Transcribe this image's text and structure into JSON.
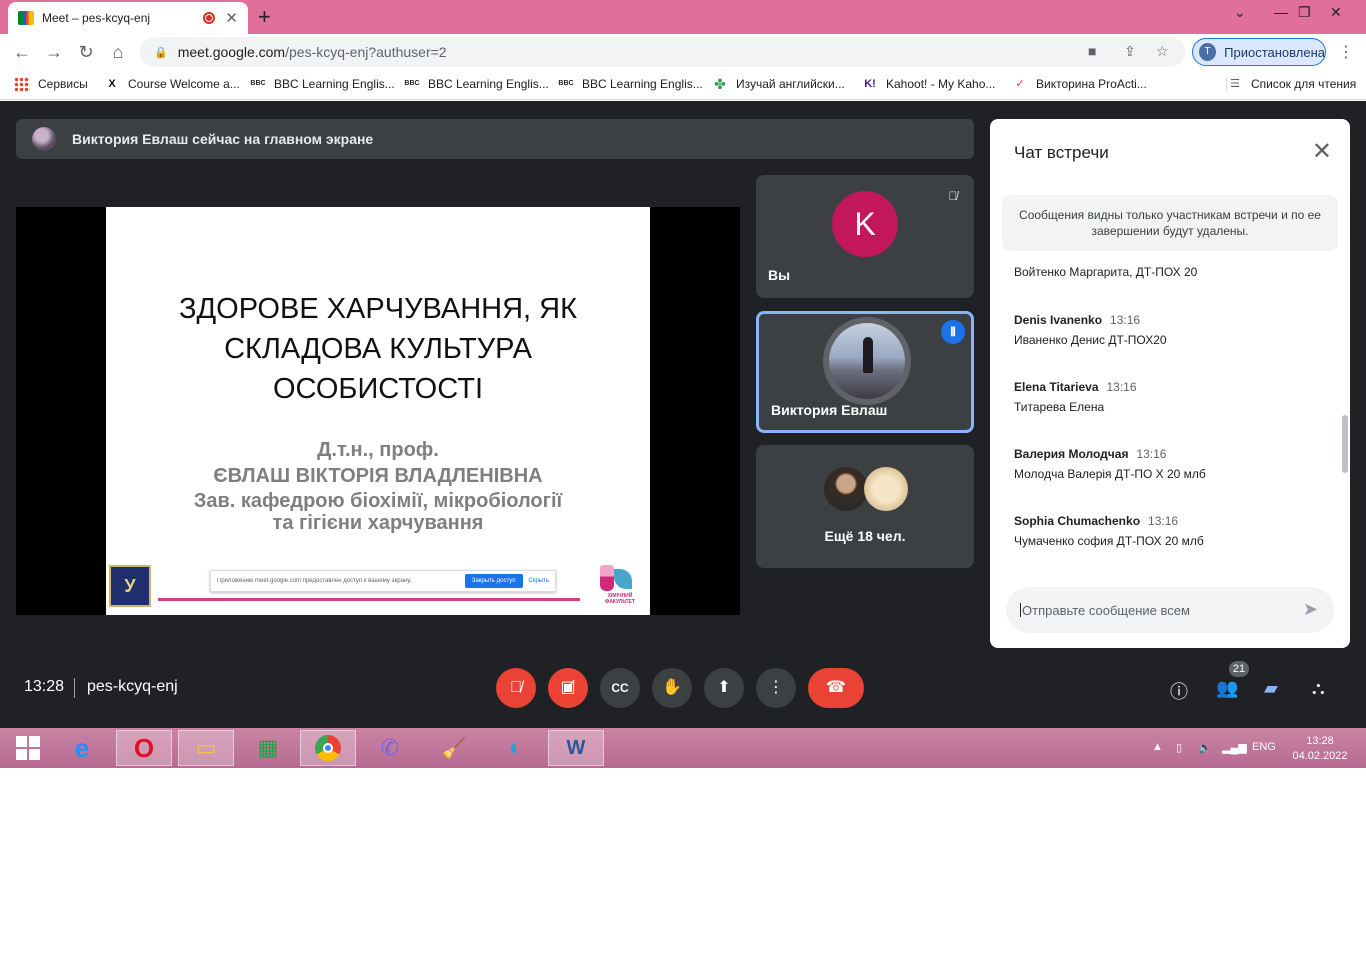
{
  "browser": {
    "tab_title": "Meet – pes-kcyq-enj",
    "url_host": "meet.google.com",
    "url_path": "/pes-kcyq-enj?authuser=2",
    "profile_label": "Приостановлена",
    "profile_initial": "Т",
    "bookmarks": [
      {
        "label": "Сервисы",
        "icon": "apps-grid-icon"
      },
      {
        "label": "Course Welcome a...",
        "icon": "x-icon"
      },
      {
        "label": "BBC Learning Englis...",
        "icon": "bbc-icon"
      },
      {
        "label": "BBC Learning Englis...",
        "icon": "bbc-icon"
      },
      {
        "label": "BBC Learning Englis...",
        "icon": "bbc-icon"
      },
      {
        "label": "Изучай английски...",
        "icon": "clover-icon"
      },
      {
        "label": "Kahoot! - My Kaho...",
        "icon": "kahoot-icon"
      },
      {
        "label": "Викторина ProActi...",
        "icon": "checkmark-icon"
      }
    ],
    "reading_list": "Список для чтения"
  },
  "meet": {
    "presenter_notice": "Виктория Евлаш сейчас на главном экране",
    "slide": {
      "title_lines": [
        "ЗДОРОВЕ ХАРЧУВАННЯ, ЯК",
        "СКЛАДОВА КУЛЬТУРА",
        "ОСОБИСТОСТІ"
      ],
      "author_lines": [
        "Д.т.н., проф.",
        "ЄВЛАШ ВІКТОРІЯ ВЛАДЛЕНІВНА",
        "Зав. кафедрою біохімії, мікробіології",
        "та гігієни харчування"
      ],
      "share_notice": "Приложению meet.google.com предоставлен доступ к вашему экрану.",
      "share_stop": "Закрыть доступ",
      "share_hide": "Скрыть",
      "faculty_label": "ХІМІЧНИЙ ФАКУЛЬТЕТ"
    },
    "tiles": {
      "you_initial": "K",
      "you_label": "Вы",
      "speaker_name": "Виктория Евлаш",
      "more_label": "Ещё 18 чел."
    },
    "chat": {
      "title": "Чат встречи",
      "notice": "Сообщения видны только участникам встречи и по ее завершении будут удалены.",
      "first_line": "Войтенко Маргарита, ДТ-ПОХ 20",
      "messages": [
        {
          "sender": "Denis Ivanenko",
          "time": "13:16",
          "text": "Иваненко Денис ДТ-ПОХ20"
        },
        {
          "sender": "Elena Titarieva",
          "time": "13:16",
          "text": "Титарева Елена"
        },
        {
          "sender": "Валерия Молодчая",
          "time": "13:16",
          "text": "Молодча Валерія ДТ-ПО Х 20 млб"
        },
        {
          "sender": "Sophia Chumachenko",
          "time": "13:16",
          "text": "Чумаченко софия ДТ-ПОХ 20 млб"
        }
      ],
      "input_placeholder": "Отправьте сообщение всем"
    },
    "bottom": {
      "time": "13:28",
      "meeting_code": "pes-kcyq-enj",
      "participants_count": "21"
    }
  },
  "taskbar": {
    "language": "ENG",
    "time": "13:28",
    "date": "04.02.2022"
  },
  "colors": {
    "tab_strip": "#e06f9c",
    "meet_bg": "#202124",
    "tile_bg": "#3c4043",
    "accent_blue": "#1a73e8",
    "danger_red": "#ea4335",
    "taskbar": "#b86a92"
  }
}
